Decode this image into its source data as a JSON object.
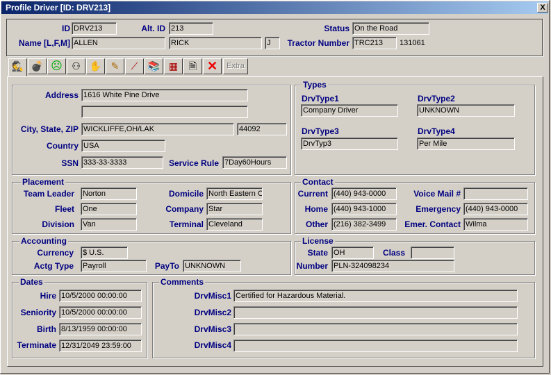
{
  "window": {
    "title": "Profile Driver  [ID: DRV213]",
    "close": "X"
  },
  "header": {
    "id_label": "ID",
    "id": "DRV213",
    "altid_label": "Alt. ID",
    "altid": "213",
    "status_label": "Status",
    "status": "On the Road",
    "name_label": "Name [L,F,M]",
    "last": "ALLEN",
    "first": "RICK",
    "middle": "J",
    "tractor_label": "Tractor Number",
    "tractor": "TRC213",
    "tractor_extra": "131061"
  },
  "toolbar": {
    "icons": [
      "driver-profile-icon",
      "bomb-icon",
      "sad-face-icon",
      "binoculars-icon",
      "hand-icon",
      "pencil-icon",
      "wrench-icon",
      "books-icon",
      "calculator-icon",
      "document-icon",
      "delete-icon"
    ],
    "extra": "Extra"
  },
  "address": {
    "address_label": "Address",
    "address1": "1616 White Pine Drive",
    "address2": "",
    "city_label": "City, State, ZIP",
    "city": "WICKLIFFE,OH/LAK",
    "zip": "44092",
    "country_label": "Country",
    "country": "USA",
    "ssn_label": "SSN",
    "ssn": "333-33-3333",
    "rule_label": "Service Rule",
    "rule": "7Day60Hours"
  },
  "types": {
    "title": "Types",
    "t1_label": "DrvType1",
    "t1": "Company Driver",
    "t2_label": "DrvType2",
    "t2": "UNKNOWN",
    "t3_label": "DrvType3",
    "t3": "DrvTyp3",
    "t4_label": "DrvType4",
    "t4": "Per Mile"
  },
  "placement": {
    "title": "Placement",
    "team_label": "Team Leader",
    "team": "Norton",
    "fleet_label": "Fleet",
    "fleet": "One",
    "division_label": "Division",
    "division": "Van",
    "domicile_label": "Domicile",
    "domicile": "North Eastern OI",
    "company_label": "Company",
    "company": "Star",
    "terminal_label": "Terminal",
    "terminal": "Cleveland"
  },
  "contact": {
    "title": "Contact",
    "current_label": "Current",
    "current": "(440) 943-0000",
    "home_label": "Home",
    "home": "(440) 943-1000",
    "other_label": "Other",
    "other": "(216) 382-3499",
    "vm_label": "Voice Mail #",
    "vm": "",
    "em_label": "Emergency",
    "em": "(440) 943-0000",
    "emc_label": "Emer. Contact",
    "emc": "Wilma"
  },
  "accounting": {
    "title": "Accounting",
    "currency_label": "Currency",
    "currency": "$ U.S.",
    "actg_label": "Actg Type",
    "actg": "Payroll",
    "payto_label": "PayTo",
    "payto": "UNKNOWN"
  },
  "license": {
    "title": "License",
    "state_label": "State",
    "state": "OH",
    "class_label": "Class",
    "class": "",
    "number_label": "Number",
    "number": "PLN-324098234"
  },
  "dates": {
    "title": "Dates",
    "hire_label": "Hire",
    "hire": "10/5/2000 00:00:00",
    "seniority_label": "Seniority",
    "seniority": "10/5/2000 00:00:00",
    "birth_label": "Birth",
    "birth": "8/13/1959 00:00:00",
    "terminate_label": "Terminate",
    "terminate": "12/31/2049 23:59:00"
  },
  "comments": {
    "title": "Comments",
    "m1_label": "DrvMisc1",
    "m1": "Certified for Hazardous Material.",
    "m2_label": "DrvMisc2",
    "m2": "",
    "m3_label": "DrvMisc3",
    "m3": "",
    "m4_label": "DrvMisc4",
    "m4": ""
  }
}
